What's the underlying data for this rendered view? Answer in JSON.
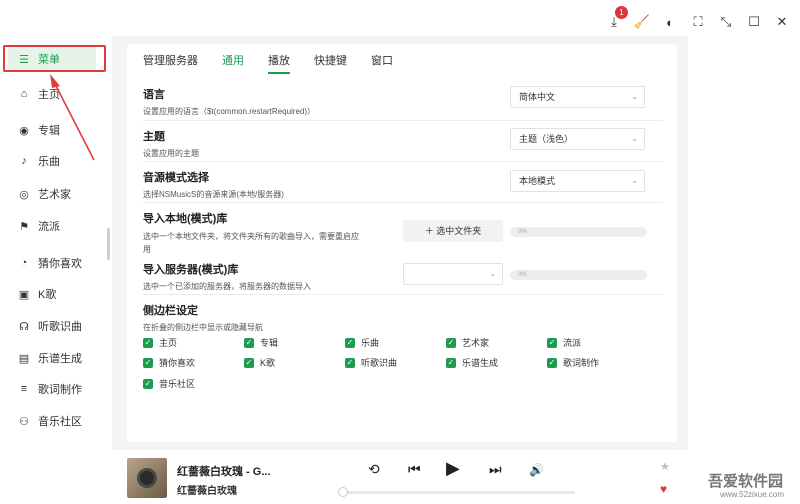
{
  "notify_count": "1",
  "sidebar": {
    "items": [
      {
        "label": "菜单",
        "icon": "menu-icon"
      },
      {
        "label": "主页",
        "icon": "home-icon"
      },
      {
        "label": "专辑",
        "icon": "album-icon"
      },
      {
        "label": "乐曲",
        "icon": "music-note-icon"
      },
      {
        "label": "艺术家",
        "icon": "artist-icon"
      },
      {
        "label": "流派",
        "icon": "flag-icon"
      },
      {
        "label": "猜你喜欢",
        "icon": "recommend-icon"
      },
      {
        "label": "K歌",
        "icon": "karaoke-icon"
      },
      {
        "label": "听歌识曲",
        "icon": "listen-icon"
      },
      {
        "label": "乐谱生成",
        "icon": "score-icon"
      },
      {
        "label": "歌词制作",
        "icon": "lyrics-icon"
      },
      {
        "label": "音乐社区",
        "icon": "community-icon"
      }
    ]
  },
  "tabs": [
    "管理服务器",
    "通用",
    "播放",
    "快捷键",
    "窗口"
  ],
  "settings": {
    "language": {
      "title": "语言",
      "desc": "设置应用的语言（$t(common.restartRequired)）",
      "value": "简体中文"
    },
    "theme": {
      "title": "主题",
      "desc": "设置应用的主题",
      "value": "主题（浅色）"
    },
    "source": {
      "title": "音源模式选择",
      "desc": "选择NSMusicS的音源来源(本地/服务器)",
      "value": "本地模式"
    },
    "import_local": {
      "title": "导入本地(模式)库",
      "desc": "选中一个本地文件夹，将文件夹所有的歌曲导入，需要重启应用",
      "button": "＋ 选中文件夹",
      "progress": "0%"
    },
    "import_server": {
      "title": "导入服务器(模式)库",
      "desc": "选中一个已添加的服务器，将服务器的数据导入",
      "progress": "0%"
    },
    "sidebar_setting": {
      "title": "侧边栏设定",
      "desc": "在折叠的侧边栏中显示或隐藏导航"
    }
  },
  "checks": [
    "主页",
    "专辑",
    "乐曲",
    "艺术家",
    "流派",
    "猜你喜欢",
    "K歌",
    "听歌识曲",
    "乐谱生成",
    "歌词制作",
    "音乐社区"
  ],
  "player": {
    "song": "红蔷薇白玫瑰 - G...",
    "artist": "红蔷薇白玫瑰"
  },
  "watermark": {
    "text": "吾爱软件园",
    "url": "www.52zixue.com"
  }
}
